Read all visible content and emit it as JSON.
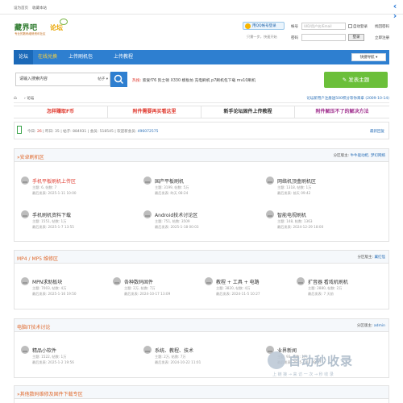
{
  "topbar": {
    "set_home": "设为首页",
    "bookmark": "收藏本站"
  },
  "logo": {
    "name": "藏界吧",
    "sub": "专业的数码维修资讯社区",
    "forum": "论坛"
  },
  "login": {
    "qq_button": "用QQ帐号登录",
    "qq_hint": "只需一步，快速开始",
    "account_label": "帐号",
    "account_placeholder": "UID/用户名/Email",
    "auto_login": "自动登录",
    "forgot": "找回密码",
    "password_label": "密码",
    "login_button": "登录",
    "register": "立即注册"
  },
  "nav": {
    "items": [
      "论坛",
      "在线兑换",
      "上传刷机包",
      "上传教程"
    ],
    "quick": "快捷导航"
  },
  "search": {
    "placeholder": "请输入搜索内容",
    "value": "请输入搜索内容",
    "type": "帖子",
    "hot_label": "热搜:",
    "hot_words": "索爱f76  凯士顿  X330  模板坊  充电刷机  p7刷机包下载  mv10刷机",
    "post_button": "发表主题"
  },
  "breadcrumb": {
    "home_icon": "home-icon",
    "current": "论坛",
    "notice": "论坛新用户注册送500积分等你来拿 (2009-10-14)"
  },
  "banners": [
    {
      "text": "怎样赚取F币",
      "color": "#e03c31"
    },
    {
      "text": "附件需要再买看这里",
      "color": "#e03c31"
    },
    {
      "text": "新手论坛固件上传教程",
      "color": "#333333"
    },
    {
      "text": "附件解压不了的解决方法",
      "color": "#a0308e"
    }
  ],
  "stats": {
    "today_label": "今日: ",
    "today": "26",
    "yesterday_label": "昨日: ",
    "yesterday": "35",
    "posts_label": "帖子: ",
    "posts": "884931",
    "members_label": "会员: ",
    "members": "518545",
    "newest_label": "欢迎新会员: ",
    "newest": "496072575",
    "latest_reply": "最新回复"
  },
  "sections": [
    {
      "title": "»安卓刷机区",
      "moderator_label": "分区版主:",
      "moderators": "牛牛驱动柜, 梦幻网络",
      "forums": [
        {
          "name": "手机平板刷机上传区",
          "color": "#e03c31",
          "stats": "主题: 6, 帖数: 7",
          "last": "最后发表: 2025-1-11 10:00"
        },
        {
          "name": "国产平板刷机",
          "color": "#333333",
          "stats": "主题: 3199, 帖数: 5万",
          "last": "最后发表: 昨天 08:24"
        },
        {
          "name": "网络机顶盒刷机区",
          "color": "#333333",
          "stats": "主题: 1318, 帖数: 1万",
          "last": "最后发表: 前天 09:42"
        },
        {
          "name": "手机刷机资料下载",
          "color": "#333333",
          "stats": "主题: 1551, 帖数: 1万",
          "last": "最后发表: 2025-1-7 13:55"
        },
        {
          "name": "Android技术讨论区",
          "color": "#333333",
          "stats": "主题: 751, 帖数: 3509",
          "last": "最后发表: 2025-1-18 00:03"
        },
        {
          "name": "智能电视刷机",
          "color": "#333333",
          "stats": "主题: 148, 帖数: 1363",
          "last": "最后发表: 2024-12-29 18:00"
        }
      ]
    },
    {
      "title": "MP4 / MP5 维修区",
      "moderator_label": "分区版主:",
      "moderators": "翼红怪",
      "forums": [
        {
          "name": "MPN求助板块",
          "color": "#333333",
          "stats": "主题: 7003, 帖数: 4万",
          "last": "最后发表: 2025-1-16 19:50"
        },
        {
          "name": "各种数码固件",
          "color": "#333333",
          "stats": "主题: 2万, 帖数: 7万",
          "last": "最后发表: 2024-10-17 13:09"
        },
        {
          "name": "教程 + 工具 + 电路",
          "color": "#333333",
          "stats": "主题: 3820, 帖数: 4万",
          "last": "最后发表: 2024-11-5 10:27"
        },
        {
          "name": "扩音器 看戏机刷机",
          "color": "#333333",
          "stats": "主题: 2880, 帖数: 2万",
          "last": "最后发表: 7 天前"
        }
      ]
    },
    {
      "title": "电脑IT技术讨论",
      "moderator_label": "分区版主:",
      "moderators": "admin",
      "forums": [
        {
          "name": "精品小软件",
          "color": "#333333",
          "stats": "主题: 1522, 帖数: 1万",
          "last": "最后发表: 2025-1-2 19:56"
        },
        {
          "name": "系统、教程、技术",
          "color": "#333333",
          "stats": "主题: 2万, 帖数: 7万",
          "last": "最后发表: 2024-10-22 11:01"
        },
        {
          "name": "业界新闻",
          "color": "#333333",
          "stats": "主题: 93, 帖数: 1万",
          "last": "最后发表: 2025-1-15 08:07"
        }
      ]
    },
    {
      "title": "»其他数码维修及固件下载专区",
      "moderator_label": "",
      "moderators": "",
      "forums": []
    }
  ],
  "watermark": {
    "text": "自动秒收录",
    "sub": "上 链 接 → 来 访 一 次 → 秒 收 录"
  }
}
